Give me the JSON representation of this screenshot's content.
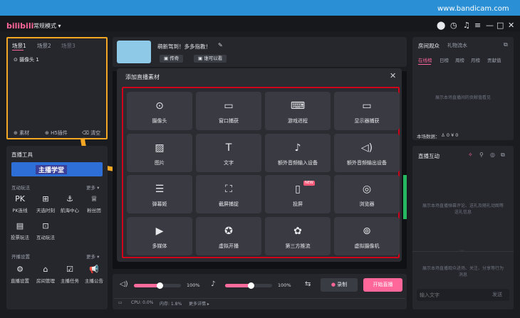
{
  "header": {
    "logo": "bilibili",
    "mode_label": "常规模式 ▾",
    "watermark": "www.bandicam.com"
  },
  "window_icons": [
    "avatar-icon",
    "clock-icon",
    "bell-icon",
    "menu-icon",
    "minimize-icon",
    "maximize-icon",
    "close-icon"
  ],
  "scenes": {
    "tabs": [
      "场景1",
      "场景2",
      "场景3"
    ],
    "items": [
      "摄像头 1"
    ],
    "actions": [
      "素材",
      "H5插件",
      "清空"
    ]
  },
  "tools": {
    "title": "直播工具",
    "banner_text": "主播学堂",
    "interactive": {
      "title": "互动玩法",
      "more": "更多 ▾",
      "items": [
        "PK连线",
        "天选时刻",
        "航海中心",
        "粉丝团",
        "投票玩法",
        "互动玩法"
      ]
    },
    "settings": {
      "title": "开播设置",
      "more": "更多 ▾",
      "items": [
        "直播设置",
        "房间管理",
        "主播任务",
        "主播公告"
      ]
    }
  },
  "room": {
    "title": "萌新驾到！多多指教！",
    "buttons": [
      "传奇",
      "谁可以看"
    ]
  },
  "dialog": {
    "title": "添加直播素材",
    "tiles": [
      {
        "label": "摄像头",
        "icon": "camera-icon"
      },
      {
        "label": "窗口捕获",
        "icon": "window-icon"
      },
      {
        "label": "游戏进程",
        "icon": "gamepad-icon"
      },
      {
        "label": "显示器捕获",
        "icon": "monitor-icon"
      },
      {
        "label": "图片",
        "icon": "image-icon"
      },
      {
        "label": "文字",
        "icon": "text-icon"
      },
      {
        "label": "额外音频输入设备",
        "icon": "microphone-icon"
      },
      {
        "label": "额外音频输出设备",
        "icon": "speaker-icon"
      },
      {
        "label": "弹幕姬",
        "icon": "danmaku-icon"
      },
      {
        "label": "截屏捕捉",
        "icon": "screenshot-icon"
      },
      {
        "label": "投屏",
        "icon": "cast-icon"
      },
      {
        "label": "浏览器",
        "icon": "compass-icon"
      },
      {
        "label": "多媒体",
        "icon": "play-icon"
      },
      {
        "label": "虚拟开播",
        "icon": "virtual-icon"
      },
      {
        "label": "第三方推流",
        "icon": "stream-icon"
      },
      {
        "label": "虚拟摄像机",
        "icon": "obs-icon"
      }
    ],
    "new_badge": "NEW"
  },
  "audio": {
    "speaker_volume": 100,
    "speaker_label": "100%",
    "mic_volume": 100,
    "mic_label": "100%"
  },
  "actions": {
    "record": "录制",
    "go_live": "开始直播"
  },
  "status": {
    "cpu": "CPU: 0.0%",
    "mem": "内存: 1.8%",
    "more": "更多详情 ▸"
  },
  "audience": {
    "title": "房间观众",
    "subtitle": "礼物流水",
    "tabs": [
      "在线榜",
      "日榜",
      "周榜",
      "月榜",
      "贡献值"
    ],
    "empty": "展示本场直播间的贡献值看见",
    "stats_label": "本场数据：",
    "stats": "♙ 0  ¥ 0"
  },
  "chat": {
    "title": "直播互动",
    "empty": "展示本场直播弹幕评论、送礼及随礼动图等送礼信息",
    "bottom_empty": "展示本场直播观众进场、关注、分享等行为消息",
    "input_placeholder": "输入文字",
    "send": "发送"
  },
  "colors": {
    "accent": "#ff6699",
    "highlight_orange": "#f5a623",
    "highlight_red": "#d0021b",
    "live_green": "#25b860"
  }
}
